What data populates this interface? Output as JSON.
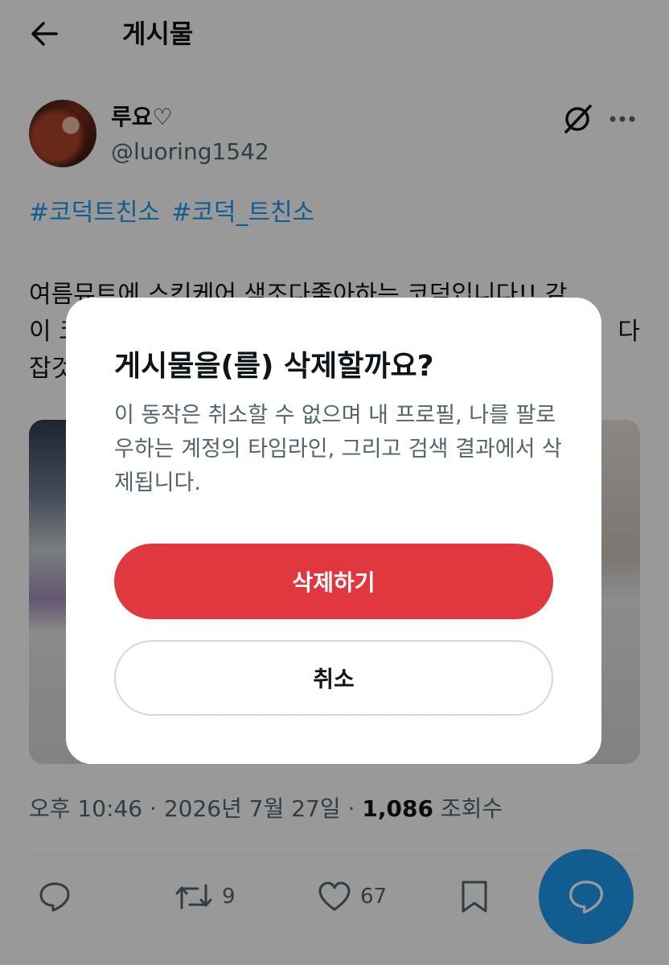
{
  "header": {
    "title": "게시물"
  },
  "author": {
    "name": "루요♡",
    "handle": "@luoring1542"
  },
  "tweet": {
    "hashtags": [
      "#코덕트친소",
      "#코덕_트친소"
    ],
    "text_lines": [
      "여름뮤트에 스킨케어 색조다좋아하는 코덕입니다!! 같",
      "이 코",
      "다",
      "잡것"
    ]
  },
  "meta": {
    "time": "오후 10:46",
    "sep1": "·",
    "date": "2026년 7월 27일",
    "sep2": "·",
    "views_count": "1,086",
    "views_label": "조회수"
  },
  "actions": {
    "retweets": "9",
    "likes": "67"
  },
  "dialog": {
    "title": "게시물을(를) 삭제할까요?",
    "message": "이 동작은 취소할 수 없으며 내 프로필, 나를 팔로우하는 계정의 타임라인, 그리고 검색 결과에서 삭제됩니다.",
    "delete_label": "삭제하기",
    "cancel_label": "취소"
  },
  "colors": {
    "accent": "#1d9bf0",
    "danger": "#e0383e",
    "muted": "#536471"
  },
  "icons": [
    "back-arrow-icon",
    "grok-icon",
    "more-icon",
    "reply-icon",
    "retweet-icon",
    "heart-icon",
    "bookmark-icon",
    "compose-reply-icon"
  ]
}
